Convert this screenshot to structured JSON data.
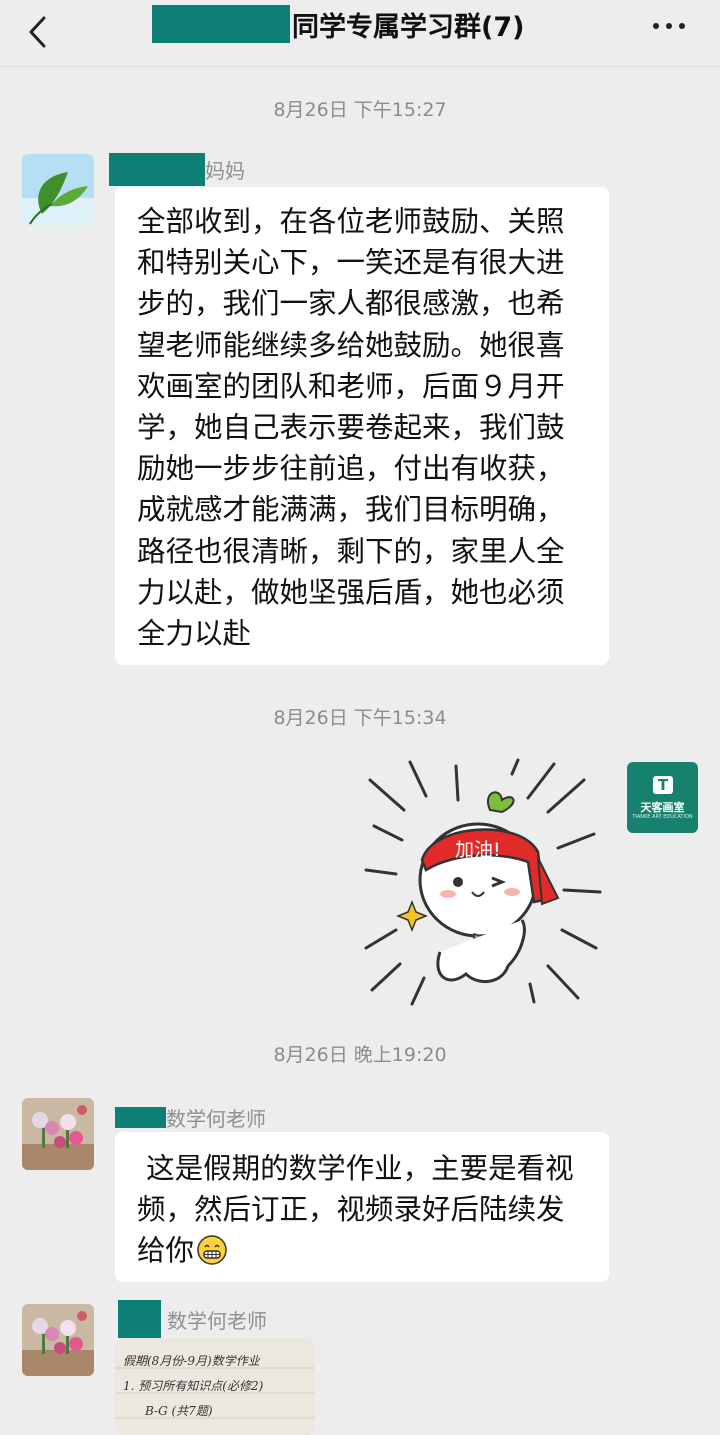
{
  "header": {
    "title": "同学专属学习群(7)"
  },
  "messages": [
    {
      "timestamp": "8月26日 下午15:27",
      "sender_suffix": "妈妈",
      "text": "全部收到，在各位老师鼓励、关照和特别关心下，一笑还是有很大进步的，我们一家人都很感激，也希望老师能继续多给她鼓励。她很喜欢画室的团队和老师，后面９月开学，她自己表示要卷起来，我们鼓励她一步步往前追，付出有收获，成就感才能满满，我们目标明确，路径也很清晰，剩下的，家里人全力以赴，做她坚强后盾，她也必须全力以赴"
    },
    {
      "timestamp": "8月26日 下午15:34",
      "sticker_text": "加油!",
      "avatar_logo_letter": "T",
      "avatar_logo_text": "天客画室",
      "avatar_logo_subtext": "TIANKE ART EDUCATION"
    },
    {
      "timestamp": "8月26日 晚上19:20",
      "sender_suffix": "数学何老师",
      "text": " 这是假期的数学作业，主要是看视频，然后订正，视频录好后陆续发给你"
    },
    {
      "sender_suffix": "数学何老师",
      "image_lines": [
        "假期(8月份-9月)数学作业",
        "1. 预习所有知识点(必修2)",
        "B-G (共7题)"
      ]
    }
  ],
  "colors": {
    "background": "#ededed",
    "bubble": "#ffffff",
    "redaction": "#0e7f74",
    "timestamp": "#8c8c8c"
  },
  "icons": {
    "back": "chevron-left-icon",
    "more": "more-dots-icon"
  }
}
